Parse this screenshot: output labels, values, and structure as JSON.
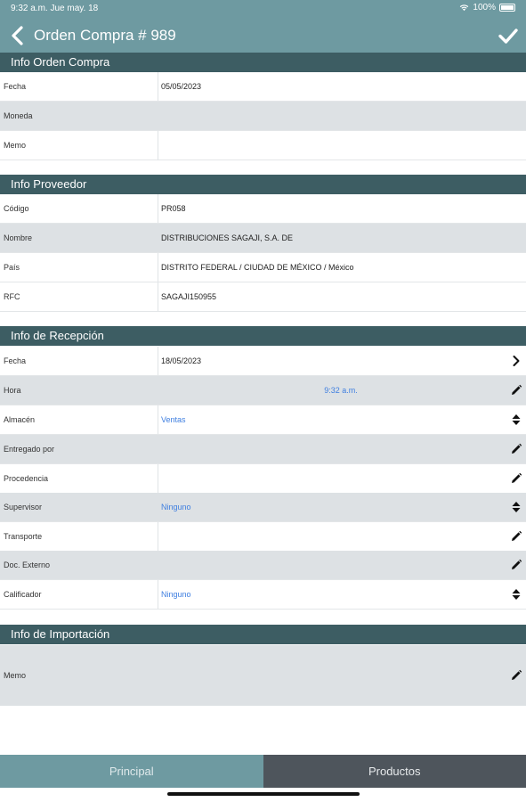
{
  "status_bar": {
    "time": "9:32 a.m.",
    "date": "Jue may. 18",
    "battery": "100%"
  },
  "nav": {
    "title": "Orden Compra # 989"
  },
  "sections": {
    "orden": {
      "header": "Info Orden Compra",
      "rows": [
        {
          "label": "Fecha",
          "value": "05/05/2023"
        },
        {
          "label": "Moneda",
          "value": ""
        },
        {
          "label": "Memo",
          "value": ""
        }
      ]
    },
    "proveedor": {
      "header": "Info Proveedor",
      "rows": [
        {
          "label": "Código",
          "value": "PR058"
        },
        {
          "label": "Nombre",
          "value": "DISTRIBUCIONES SAGAJI, S.A. DE"
        },
        {
          "label": "País",
          "value": "DISTRITO FEDERAL / CIUDAD DE MÉXICO / México"
        },
        {
          "label": "RFC",
          "value": "SAGAJI150955"
        }
      ]
    },
    "recepcion": {
      "header": "Info de Recepción",
      "rows": [
        {
          "label": "Fecha",
          "value": "18/05/2023",
          "icon": "chevron-right-icon"
        },
        {
          "label": "Hora",
          "value": "9:32 a.m.",
          "icon": "pencil-icon"
        },
        {
          "label": "Almacén",
          "value": "Ventas",
          "icon": "sort-icon"
        },
        {
          "label": "Entregado por",
          "value": "",
          "icon": "pencil-icon"
        },
        {
          "label": "Procedencia",
          "value": "",
          "icon": "pencil-icon"
        },
        {
          "label": "Supervisor",
          "value": "Ninguno",
          "icon": "sort-icon"
        },
        {
          "label": "Transporte",
          "value": "",
          "icon": "pencil-icon"
        },
        {
          "label": "Doc. Externo",
          "value": "",
          "icon": "pencil-icon"
        },
        {
          "label": "Calificador",
          "value": "Ninguno",
          "icon": "sort-icon"
        }
      ]
    },
    "importacion": {
      "header": "Info de Importación",
      "rows": [
        {
          "label": "Memo",
          "value": "",
          "icon": "pencil-icon"
        }
      ]
    }
  },
  "tabs": [
    {
      "label": "Principal",
      "active": true
    },
    {
      "label": "Productos",
      "active": false
    }
  ],
  "colors": {
    "nav": "#6e9aa1",
    "section_header": "#3d5d63",
    "alt_row": "#dde1e4",
    "link": "#3f7fe0",
    "tab_inactive": "#4e555c"
  }
}
